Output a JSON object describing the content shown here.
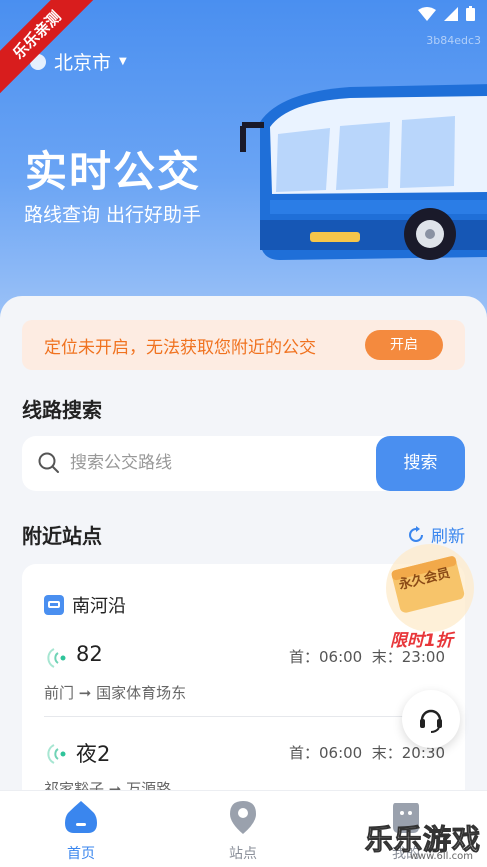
{
  "hero": {
    "city": "北京市",
    "title": "实时公交",
    "subtitle": "路线查询 出行好助手",
    "watermark_top": "3b84edc3",
    "watermark_mid": "84edc3",
    "ribbon": "乐乐亲测"
  },
  "location_banner": {
    "text": "定位未开启，无法获取您附近的公交",
    "button": "开启"
  },
  "route_search": {
    "title": "线路搜索",
    "placeholder": "搜索公交路线",
    "button": "搜索"
  },
  "nearby": {
    "title": "附近站点",
    "refresh": "刷新",
    "stop_name": "南河沿",
    "routes": [
      {
        "number": "82",
        "first": "首：06:00",
        "last": "末：23:00",
        "from": "前门",
        "to": "国家体育场东"
      },
      {
        "number": "夜2",
        "first": "首：06:00",
        "last": "末：20:30",
        "from": "祁家豁子",
        "to": "万源路"
      }
    ]
  },
  "promo": {
    "badge": "永久会员",
    "label": "限时1折"
  },
  "tabbar": {
    "tabs": [
      {
        "label": "首页"
      },
      {
        "label": "站点"
      },
      {
        "label": "我的"
      }
    ]
  },
  "site_mark": "乐乐游戏",
  "site_url": "www.6ll.com",
  "colors": {
    "primary": "#4a8ff0",
    "orange": "#f48a3e",
    "green": "#2fc49a"
  }
}
